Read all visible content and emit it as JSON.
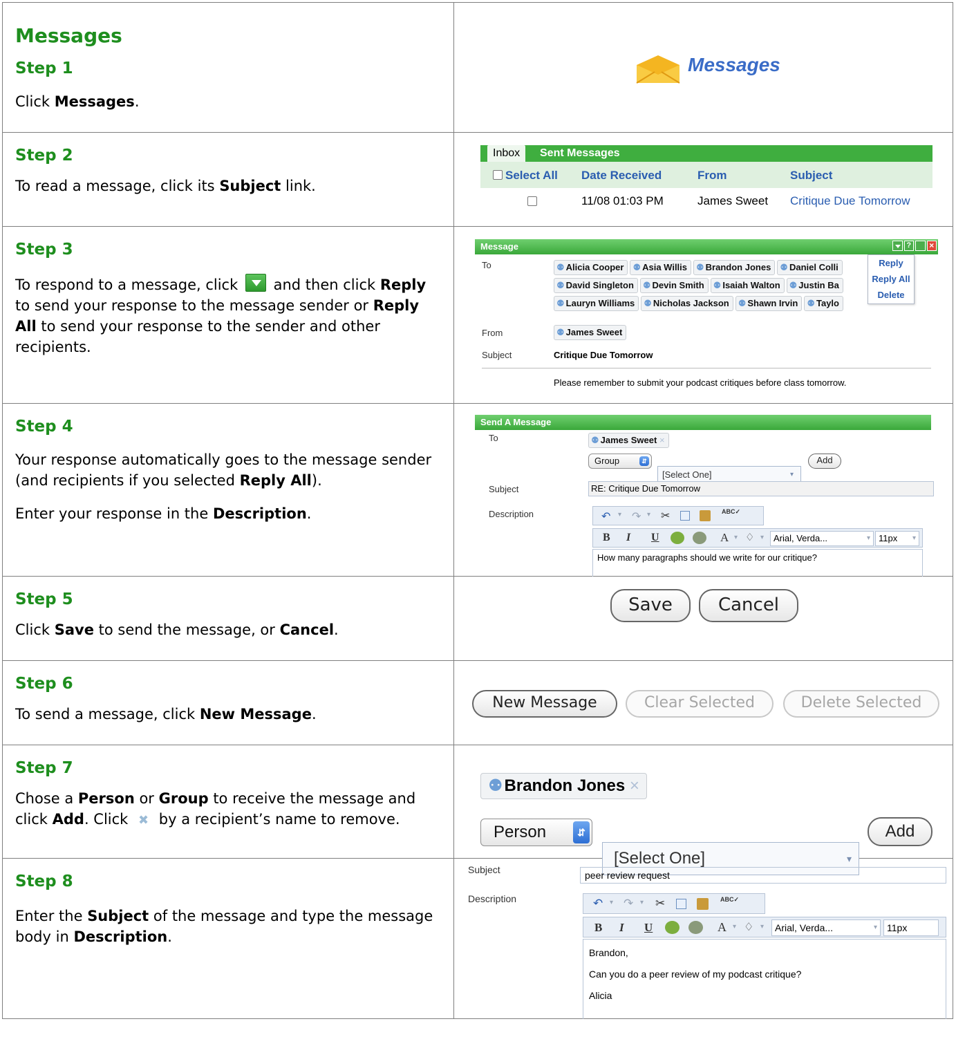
{
  "doc": {
    "title": "Messages"
  },
  "steps": [
    {
      "title": "Step 1",
      "text_pre": "Click ",
      "bold": "Messages",
      "text_post": "."
    },
    {
      "title": "Step 2",
      "text_pre": "To read a message, click its ",
      "bold": "Subject",
      "text_post": " link."
    },
    {
      "title": "Step 3",
      "text_a": "To respond to a message, click ",
      "text_b": " and then click ",
      "bold_reply": "Reply",
      "text_c": " to send your response to the message sender or ",
      "bold_reply_all": "Reply All",
      "text_d": " to send your response to the sender and other recipients."
    },
    {
      "title": "Step 4",
      "p1_pre": "Your response automatically goes to the message sender (and recipients if you selected ",
      "p1_bold": "Reply All",
      "p1_post": ").",
      "p2_pre": "Enter your response in the ",
      "p2_bold": "Description",
      "p2_post": "."
    },
    {
      "title": "Step 5",
      "pre": "Click ",
      "bold1": "Save",
      "mid": " to send the message, or ",
      "bold2": "Cancel",
      "post": "."
    },
    {
      "title": "Step 6",
      "pre": "To send a message, click ",
      "bold": "New Message",
      "post": "."
    },
    {
      "title": "Step 7",
      "pre": "Chose a ",
      "bold1": "Person",
      "mid1": " or ",
      "bold2": "Group",
      "mid2": " to receive the message and click ",
      "bold3": "Add",
      "mid3": ". Click ",
      "post": " by a recipient’s name to remove."
    },
    {
      "title": "Step 8",
      "pre": "Enter the ",
      "bold1": "Subject",
      "mid": " of the message and type the message body in ",
      "bold2": "Description",
      "post": "."
    }
  ],
  "shot1": {
    "label": "Messages"
  },
  "shot2": {
    "tabs": [
      "Inbox",
      "Sent Messages"
    ],
    "headers": [
      "Select All",
      "Date Received",
      "From",
      "Subject"
    ],
    "row": {
      "date": "11/08 01:03 PM",
      "from": "James Sweet",
      "subject": "Critique Due Tomorrow"
    }
  },
  "shot3": {
    "title": "Message",
    "to_label": "To",
    "recipients": [
      "Alicia Cooper",
      "Asia Willis",
      "Brandon Jones",
      "Daniel Colli",
      "David Singleton",
      "Devin Smith",
      "Isaiah Walton",
      "Justin Ba",
      "Lauryn Williams",
      "Nicholas Jackson",
      "Shawn Irvin",
      "Taylo"
    ],
    "menu": [
      "Reply",
      "Reply All",
      "Delete"
    ],
    "from_label": "From",
    "from_value": "James Sweet",
    "subject_label": "Subject",
    "subject_value": "Critique Due Tomorrow",
    "body": "Please remember to submit your podcast critiques before class tomorrow."
  },
  "shot4": {
    "title": "Send A Message",
    "to_label": "To",
    "chip": "James Sweet",
    "group_select": "Group",
    "recipient_select": "[Select One]",
    "add": "Add",
    "subject_label": "Subject",
    "subject_value": "RE: Critique Due Tomorrow",
    "description_label": "Description",
    "font_select": "Arial, Verda...",
    "size_select": "11px",
    "body": "How many paragraphs should we write for our critique?"
  },
  "shot5": {
    "save": "Save",
    "cancel": "Cancel"
  },
  "shot6": {
    "new_message": "New Message",
    "clear_selected": "Clear Selected",
    "delete_selected": "Delete Selected"
  },
  "shot7": {
    "chip": "Brandon Jones",
    "type_select": "Person",
    "recipient_select": "[Select One]",
    "add": "Add"
  },
  "shot8": {
    "subject_label": "Subject",
    "subject_value": "peer review request",
    "description_label": "Description",
    "font_select": "Arial, Verda...",
    "size_select": "11px",
    "body_lines": [
      "Brandon,",
      "Can you do a peer review of my podcast critique?",
      "Alicia"
    ]
  }
}
